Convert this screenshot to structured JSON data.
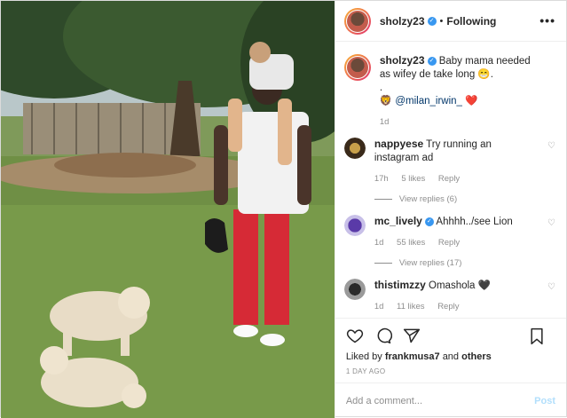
{
  "header": {
    "username": "sholzy23",
    "separator": "•",
    "follow_status": "Following",
    "more_label": "•••"
  },
  "caption": {
    "username": "sholzy23",
    "text": "Baby mama needed as wifey de take long 😁.",
    "dot": ".",
    "mention_prefix": "🦁",
    "mention": "@milan_irwin_",
    "mention_suffix": "❤️",
    "time": "1d"
  },
  "comments": [
    {
      "username": "nappyese",
      "verified": false,
      "text": "Try running an instagram ad",
      "time": "17h",
      "likes": "5 likes",
      "reply": "Reply",
      "view_replies": "View replies (6)"
    },
    {
      "username": "mc_lively",
      "verified": true,
      "text": "Ahhhh../see Lion",
      "time": "1d",
      "likes": "55 likes",
      "reply": "Reply",
      "view_replies": "View replies (17)"
    },
    {
      "username": "thistimzzy",
      "verified": false,
      "text": "Omashola 🖤",
      "time": "1d",
      "likes": "11 likes",
      "reply": "Reply",
      "view_replies": ""
    }
  ],
  "actions": {
    "like_icon": "heart-outline-icon",
    "comment_icon": "comment-bubble-icon",
    "share_icon": "paper-plane-icon",
    "save_icon": "bookmark-icon"
  },
  "likes_line": {
    "prefix": "Liked by",
    "user": "frankmusa7",
    "middle": "and",
    "others": "others"
  },
  "timestamp": "1 DAY AGO",
  "add_comment": {
    "placeholder": "Add a comment...",
    "post_label": "Post"
  },
  "colors": {
    "verified": "#3897f0",
    "muted": "#8e8e8e",
    "post_disabled": "#b2dffc"
  }
}
